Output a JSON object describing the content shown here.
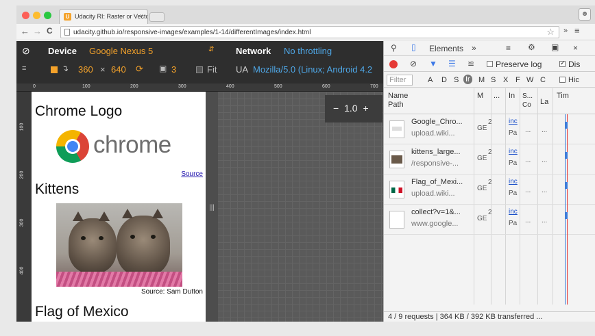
{
  "browser": {
    "tab_title": "Udacity RI: Raster or Vecto",
    "tab_favicon": "U",
    "tab_close": "×",
    "url": "udacity.github.io/responsive-images/examples/1-14/differentImages/index.html",
    "nav": {
      "back": "←",
      "forward": "→",
      "reload": "C"
    },
    "menu": "≡",
    "extensions": "»"
  },
  "device_mode": {
    "device_label": "Device",
    "device_name": "Google Nexus 5",
    "width": "360",
    "times": "×",
    "height": "640",
    "dpr": "3",
    "fit_label": "Fit",
    "network_label": "Network",
    "network_value": "No throttling",
    "ua_label": "UA",
    "ua_value": "Mozilla/5.0 (Linux; Android 4.2",
    "zoom_minus": "−",
    "zoom_value": "1.0",
    "zoom_plus": "+",
    "ruler_h": [
      "0",
      "100",
      "200",
      "300",
      "400",
      "500",
      "600",
      "700"
    ],
    "ruler_v": [
      "100",
      "200",
      "300",
      "400"
    ],
    "resize_handle": "|||"
  },
  "page": {
    "heading_chrome": "Chrome Logo",
    "chrome_wordmark": "chrome",
    "source_link": "Source",
    "heading_kittens": "Kittens",
    "kitten_caption": "Source: Sam Dutton",
    "heading_flag": "Flag of Mexico"
  },
  "devtools": {
    "tab_elements": "Elements",
    "more_tabs": "»",
    "close": "×",
    "preserve_log": "Preserve log",
    "disable_cache": "Dis",
    "hide_label": "Hic",
    "filter_placeholder": "Filter",
    "filter_types": [
      "A",
      "D",
      "S",
      "Ir",
      "M",
      "S",
      "X",
      "F",
      "W",
      "C"
    ],
    "columns": {
      "name": "Name",
      "path": "Path",
      "method": "M",
      "status": "...",
      "initiator": "In",
      "size_1": "S...",
      "size_2": "Co",
      "latency": "La",
      "timeline": "Tim"
    },
    "requests": [
      {
        "name": "Google_Chro...",
        "path": "upload.wiki...",
        "method": "GE",
        "status": "2",
        "initiator": "inc",
        "initiator_sub": "Pa",
        "size": "...",
        "time": "..."
      },
      {
        "name": "kittens_large...",
        "path": "/responsive-...",
        "method": "GE",
        "status": "2",
        "initiator": "inc",
        "initiator_sub": "Pa",
        "size": "...",
        "time": "..."
      },
      {
        "name": "Flag_of_Mexi...",
        "path": "upload.wiki...",
        "method": "GE",
        "status": "2",
        "initiator": "inc",
        "initiator_sub": "Pa",
        "size": "...",
        "time": "..."
      },
      {
        "name": "collect?v=1&...",
        "path": "www.google...",
        "method": "GE",
        "status": "2",
        "initiator": "inc",
        "initiator_sub": "Pa",
        "size": "...",
        "time": "..."
      }
    ],
    "status_bar": "4 / 9 requests | 364 KB / 392 KB transferred ..."
  },
  "colors": {
    "accent_orange": "#f4a22a",
    "accent_blue": "#4fa8e8",
    "record_red": "#e53935",
    "link_blue": "#1a0dab"
  }
}
